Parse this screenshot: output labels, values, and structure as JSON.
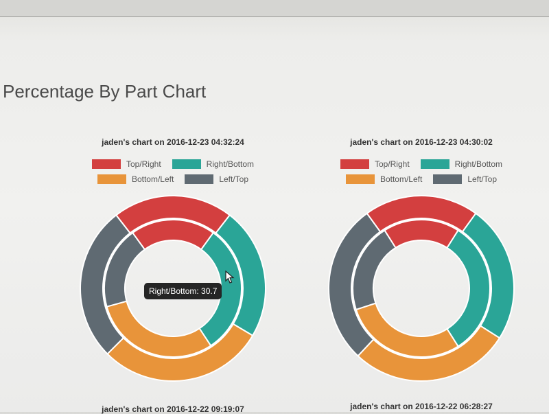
{
  "page": {
    "title": "Percentage By Part Chart"
  },
  "colors": {
    "top_right": "#d33f3f",
    "right_bottom": "#2aa597",
    "bottom_left": "#e8943a",
    "left_top": "#5f6a72"
  },
  "chart_data": [
    {
      "type": "pie",
      "title": "jaden's chart on 2016-12-23 04:32:24",
      "legend": [
        "Top/Right",
        "Right/Bottom",
        "Bottom/Left",
        "Left/Top"
      ],
      "legend_position": "top",
      "series": [
        {
          "ring": "outer",
          "values": [
            21,
            23,
            29,
            27
          ]
        },
        {
          "ring": "inner",
          "values": [
            20,
            30.7,
            30,
            19.3
          ]
        }
      ],
      "tooltip": "Right/Bottom: 30.7"
    },
    {
      "type": "pie",
      "title": "jaden's chart on 2016-12-23 04:30:02",
      "legend": [
        "Top/Right",
        "Right/Bottom",
        "Bottom/Left",
        "Left/Top"
      ],
      "legend_position": "top",
      "series": [
        {
          "ring": "outer",
          "values": [
            20,
            24,
            28,
            28
          ]
        },
        {
          "ring": "inner",
          "values": [
            18,
            32,
            29,
            21
          ]
        }
      ]
    }
  ],
  "footer": {
    "left_title": "jaden's chart on 2016-12-22 09:19:07",
    "right_title": "jaden's chart on 2016-12-22 06:28:27"
  }
}
